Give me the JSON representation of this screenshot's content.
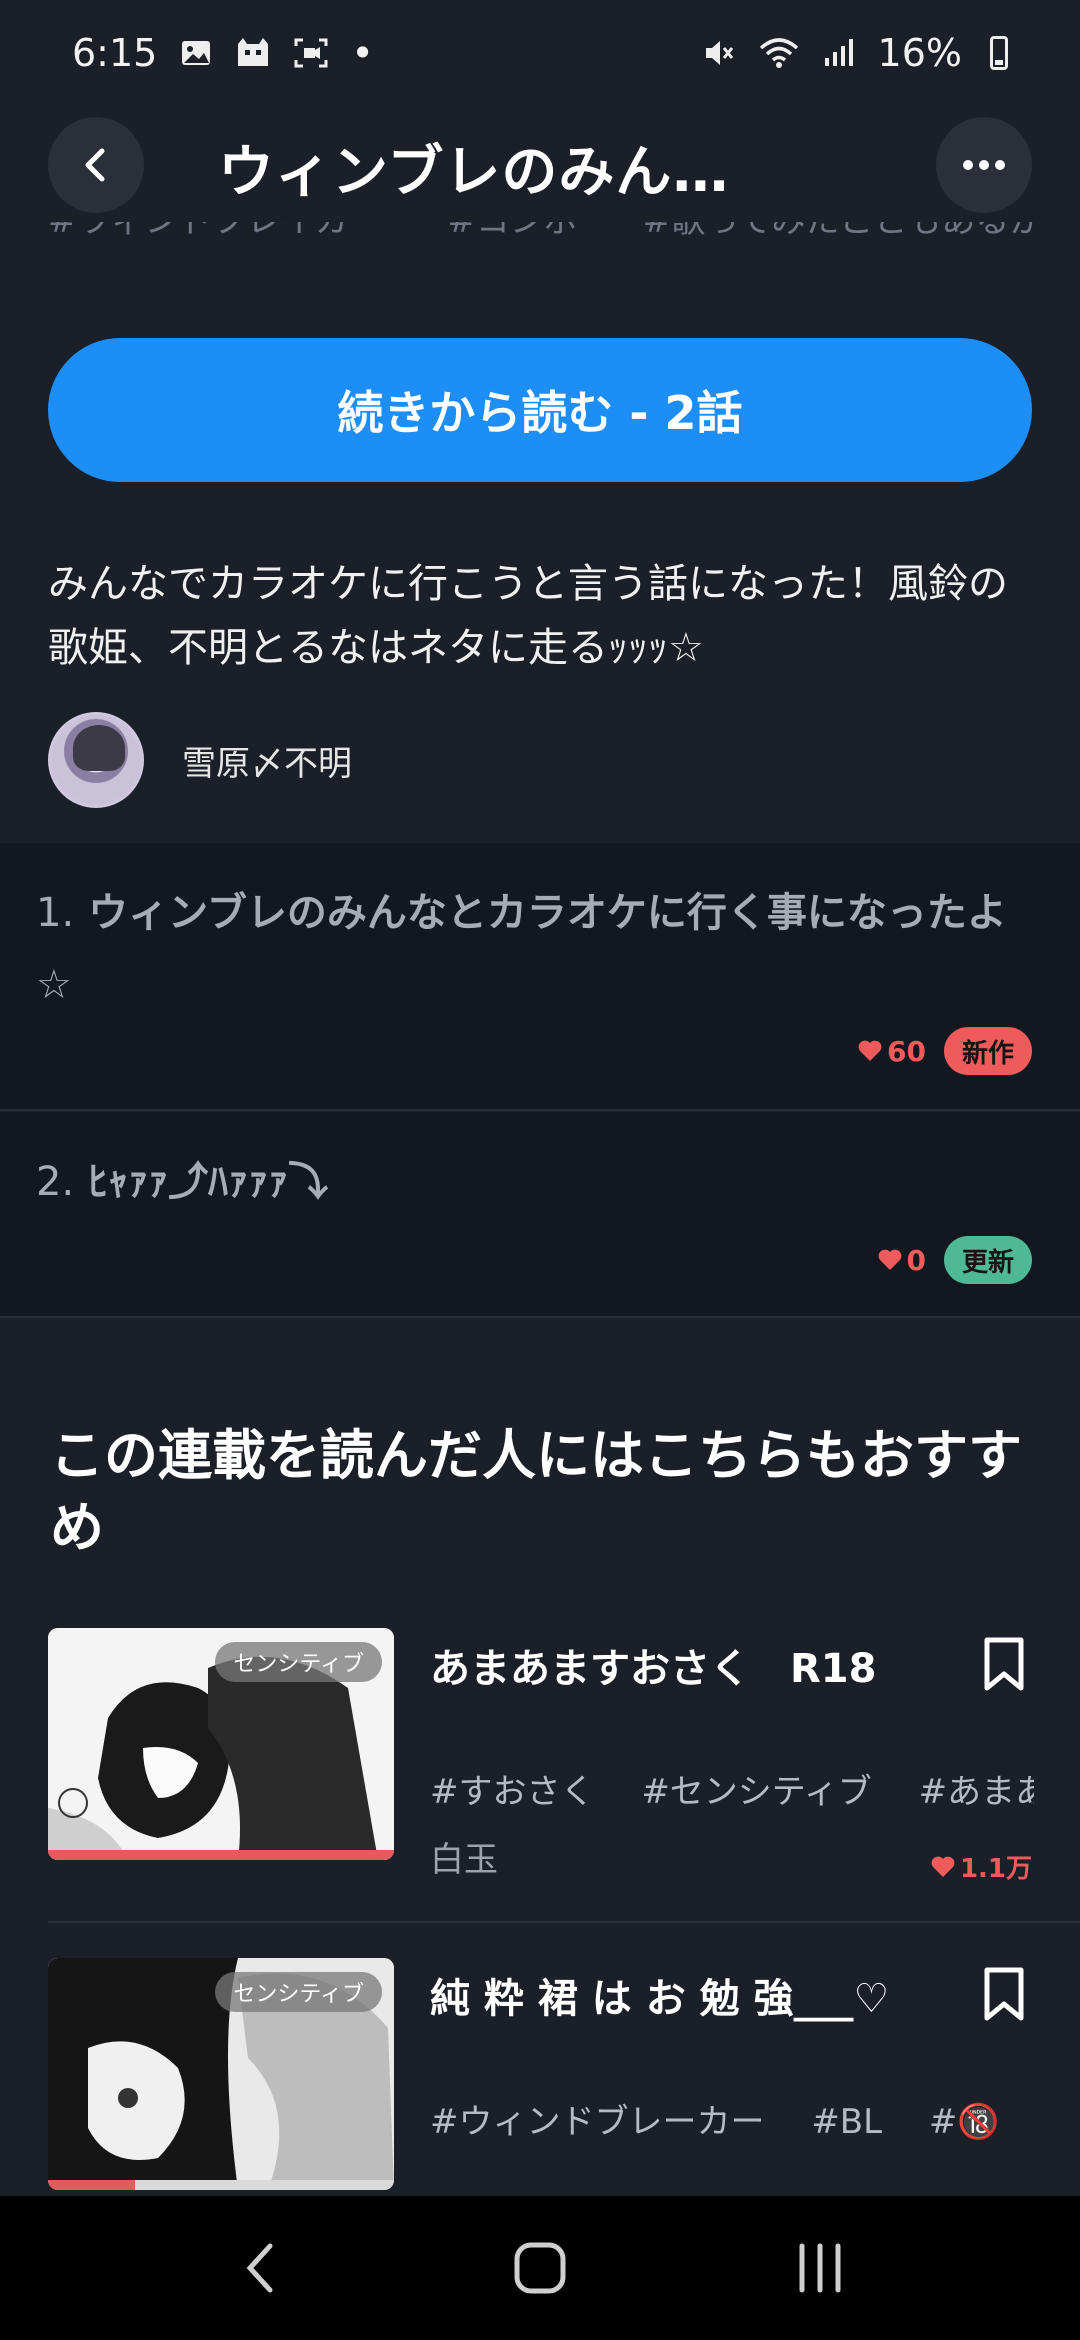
{
  "status_bar": {
    "time": "6:15",
    "dot": "•",
    "battery": "16%"
  },
  "header": {
    "title": "ウィンブレのみん…",
    "back_icon": "chevron-left-icon",
    "more_icon": "more-horizontal-icon"
  },
  "tag_strip": [
    "#ウィンドブレイカー",
    "#コンボ",
    "#歌ってみたこともあるかも"
  ],
  "continue_button": {
    "label": "続きから読む - 2話"
  },
  "description": "みんなでカラオケに行こうと言う話になった！風鈴の歌姫、不明とるなはネタに走るｯｯｯ☆",
  "author": {
    "name": "雪原〆不明"
  },
  "episodes": [
    {
      "number": "1.",
      "title": "ウィンブレのみんなとカラオケに行く事になったよ☆",
      "likes": "60",
      "badge": "新作"
    },
    {
      "number": "2.",
      "title": "ﾋｬｧｧ⤴ﾊｧｧｧ⤵",
      "likes": "0",
      "badge": "更新"
    }
  ],
  "recommendations": {
    "heading": "この連載を読んだ人にはこちらもおすすめ",
    "items": [
      {
        "title": "あまあますおさく　R18",
        "badge": "センシティブ",
        "tags": [
          "#すおさく",
          "#センシティブ",
          "#あまあ…"
        ],
        "author": "白玉",
        "likes": "1.1万",
        "progress": 1.0
      },
      {
        "title": "純 粋 裙 は お 勉 強___♡",
        "badge": "センシティブ",
        "tags": [
          "#ウィンドブレーカー",
          "#BL",
          "#🔞"
        ],
        "author": "",
        "likes": "",
        "progress": 0.25
      }
    ]
  },
  "colors": {
    "background": "#1b1f28",
    "accent": "#1e8ef7",
    "like": "#ef5b5b",
    "new_badge": "#ef5b5b",
    "update_badge": "#4fb895"
  }
}
